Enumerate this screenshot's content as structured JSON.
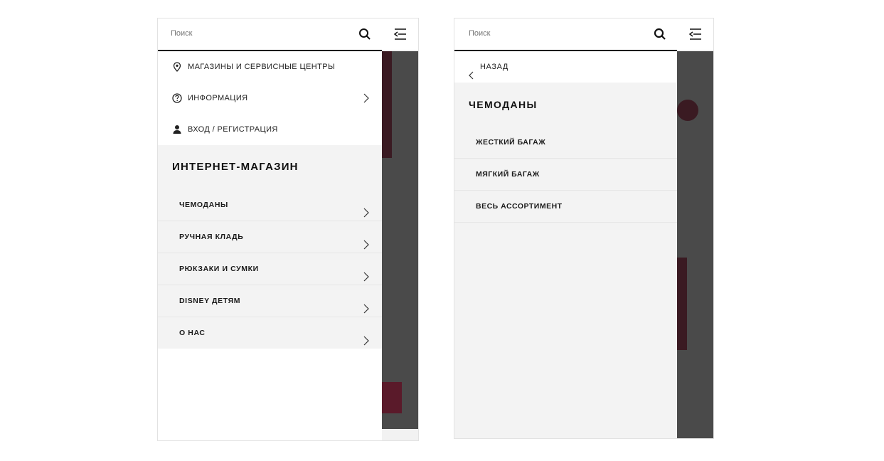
{
  "left_screen": {
    "search": {
      "placeholder": "Поиск"
    },
    "utility_items": [
      {
        "label": "МАГАЗИНЫ И СЕРВИСНЫЕ ЦЕНТРЫ",
        "icon": "location-pin-icon"
      },
      {
        "label": "ИНФОРМАЦИЯ",
        "icon": "question-circle-icon"
      },
      {
        "label": "ВХОД / РЕГИСТРАЦИЯ",
        "icon": "user-icon"
      }
    ],
    "section_title": "ИНТЕРНЕТ-МАГАЗИН",
    "categories": [
      {
        "label": "ЧЕМОДАНЫ"
      },
      {
        "label": "РУЧНАЯ КЛАДЬ"
      },
      {
        "label": "РЮКЗАКИ И СУМКИ"
      },
      {
        "label": "DISNEY ДЕТЯМ"
      },
      {
        "label": "О НАС"
      }
    ]
  },
  "right_screen": {
    "search": {
      "placeholder": "Поиск"
    },
    "back_label": "НАЗАД",
    "section_title": "ЧЕМОДАНЫ",
    "subcategories": [
      {
        "label": "ЖЕСТКИЙ БАГАЖ"
      },
      {
        "label": "МЯГКИЙ БАГАЖ"
      },
      {
        "label": "ВЕСЬ АССОРТИМЕНТ"
      }
    ]
  },
  "colors": {
    "accent_dark": "#111111",
    "drawer_bg": "#f3f3f3",
    "overlay": "#4a4a4a",
    "product_accent": "#5a1a2a"
  }
}
